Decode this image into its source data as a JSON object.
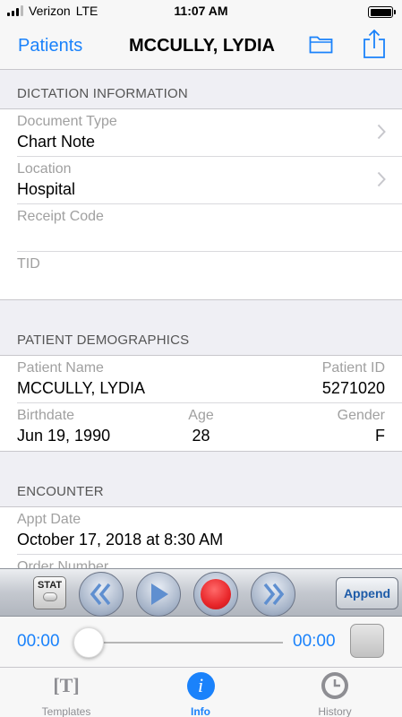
{
  "status_bar": {
    "carrier": "Verizon",
    "network": "LTE",
    "time": "11:07 AM"
  },
  "nav": {
    "back_label": "Patients",
    "title": "MCCULLY, LYDIA",
    "folder_icon": "folder-icon",
    "share_icon": "share-icon"
  },
  "dictation": {
    "header": "DICTATION INFORMATION",
    "document_type": {
      "label": "Document Type",
      "value": "Chart Note"
    },
    "location": {
      "label": "Location",
      "value": "Hospital"
    },
    "receipt_code": {
      "label": "Receipt Code",
      "value": ""
    },
    "tid": {
      "label": "TID",
      "value": ""
    }
  },
  "demographics": {
    "header": "PATIENT DEMOGRAPHICS",
    "patient_name": {
      "label": "Patient Name",
      "value": "MCCULLY, LYDIA"
    },
    "patient_id": {
      "label": "Patient ID",
      "value": "5271020"
    },
    "birthdate": {
      "label": "Birthdate",
      "value": "Jun 19, 1990"
    },
    "age": {
      "label": "Age",
      "value": "28"
    },
    "gender": {
      "label": "Gender",
      "value": "F"
    }
  },
  "encounter": {
    "header": "ENCOUNTER",
    "appt_date": {
      "label": "Appt Date",
      "value": "October 17, 2018 at 8:30 AM"
    },
    "order_number": {
      "label": "Order Number",
      "value": ""
    }
  },
  "player": {
    "stat_label": "STAT",
    "append_label": "Append",
    "current_time": "00:00",
    "total_time": "00:00",
    "progress": 0
  },
  "tabs": [
    {
      "label": "Templates",
      "icon": "templates-icon",
      "glyph": "[T]",
      "active": false
    },
    {
      "label": "Info",
      "icon": "info-icon",
      "glyph": "i",
      "active": true
    },
    {
      "label": "History",
      "icon": "history-icon",
      "active": false
    }
  ],
  "colors": {
    "accent": "#1a82fb",
    "record": "#e8262a",
    "separator": "#c8c7cc"
  }
}
